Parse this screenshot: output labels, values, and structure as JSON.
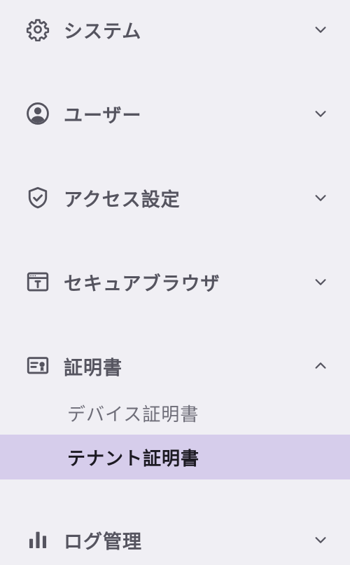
{
  "colors": {
    "background": "#f0eff4",
    "label": "#55545f",
    "icon": "#55545f",
    "subitem_label": "#6e6d78",
    "active_background": "#d6cdeb",
    "active_label": "#1c1a22"
  },
  "sidebar": {
    "sections": [
      {
        "label": "システム",
        "icon": "gear-icon",
        "expanded": false
      },
      {
        "label": "ユーザー",
        "icon": "user-circle-icon",
        "expanded": false
      },
      {
        "label": "アクセス設定",
        "icon": "shield-check-icon",
        "expanded": false
      },
      {
        "label": "セキュアブラウザ",
        "icon": "browser-window-icon",
        "expanded": false
      },
      {
        "label": "証明書",
        "icon": "certificate-icon",
        "expanded": true,
        "items": [
          {
            "label": "デバイス証明書",
            "active": false
          },
          {
            "label": "テナント証明書",
            "active": true
          }
        ]
      },
      {
        "label": "ログ管理",
        "icon": "bar-chart-icon",
        "expanded": false
      }
    ]
  }
}
